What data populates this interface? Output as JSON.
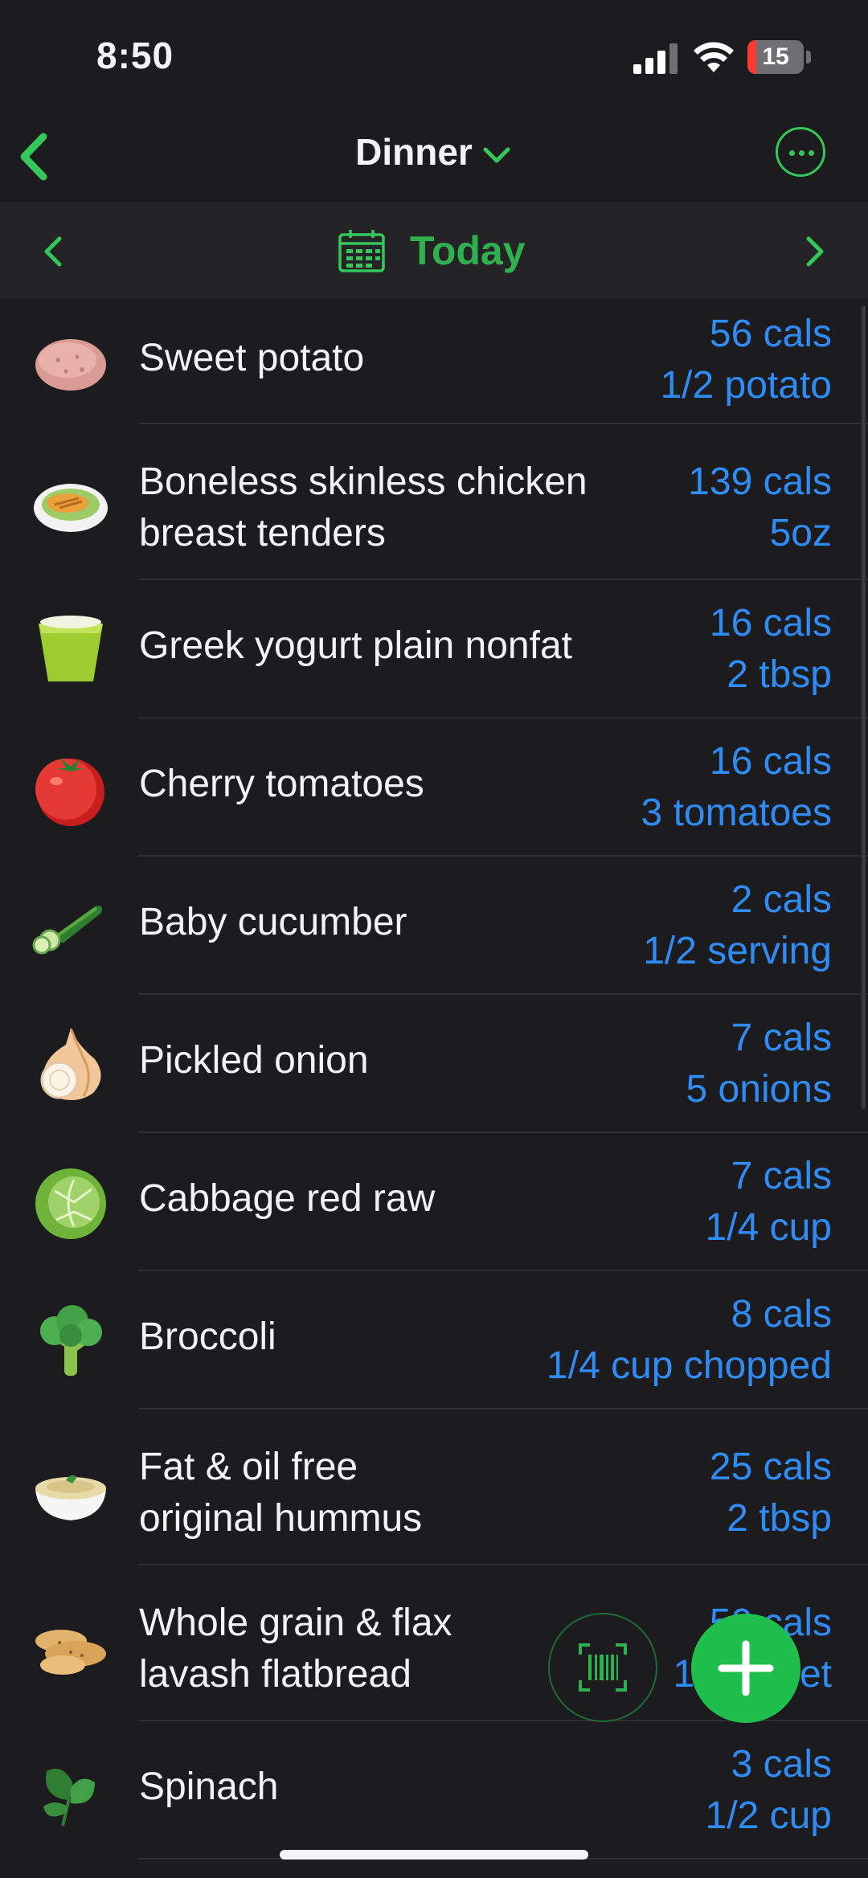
{
  "status": {
    "time": "8:50",
    "battery": "15",
    "battery_level": 0.15
  },
  "nav": {
    "title": "Dinner"
  },
  "date": {
    "label": "Today"
  },
  "colors": {
    "accent_green": "#34c759",
    "value_blue": "#2f8cf5",
    "background": "#1c1c1e"
  },
  "items": [
    {
      "icon": "sweet-potato-icon",
      "name": "Sweet potato",
      "cals": "56 cals",
      "serving": "1/2 potato"
    },
    {
      "icon": "chicken-plate-icon",
      "name": "Boneless skinless chicken\nbreast tenders",
      "cals": "139 cals",
      "serving": "5oz"
    },
    {
      "icon": "yogurt-cup-icon",
      "name": "Greek yogurt plain nonfat",
      "cals": "16 cals",
      "serving": "2 tbsp"
    },
    {
      "icon": "tomato-icon",
      "name": "Cherry tomatoes",
      "cals": "16 cals",
      "serving": "3 tomatoes"
    },
    {
      "icon": "cucumber-icon",
      "name": "Baby cucumber",
      "cals": "2 cals",
      "serving": "1/2 serving"
    },
    {
      "icon": "onion-icon",
      "name": "Pickled onion",
      "cals": "7 cals",
      "serving": "5 onions"
    },
    {
      "icon": "cabbage-icon",
      "name": "Cabbage red raw",
      "cals": "7 cals",
      "serving": "1/4 cup"
    },
    {
      "icon": "broccoli-icon",
      "name": "Broccoli",
      "cals": "8 cals",
      "serving": "1/4 cup chopped"
    },
    {
      "icon": "hummus-bowl-icon",
      "name": "Fat & oil free\noriginal hummus",
      "cals": "25 cals",
      "serving": "2 tbsp"
    },
    {
      "icon": "flatbread-icon",
      "name": "Whole grain & flax\nlavash flatbread",
      "cals": "50 cals",
      "serving": "1/2 sheet"
    },
    {
      "icon": "spinach-icon",
      "name": "Spinach",
      "cals": "3 cals",
      "serving": "1/2 cup"
    }
  ]
}
